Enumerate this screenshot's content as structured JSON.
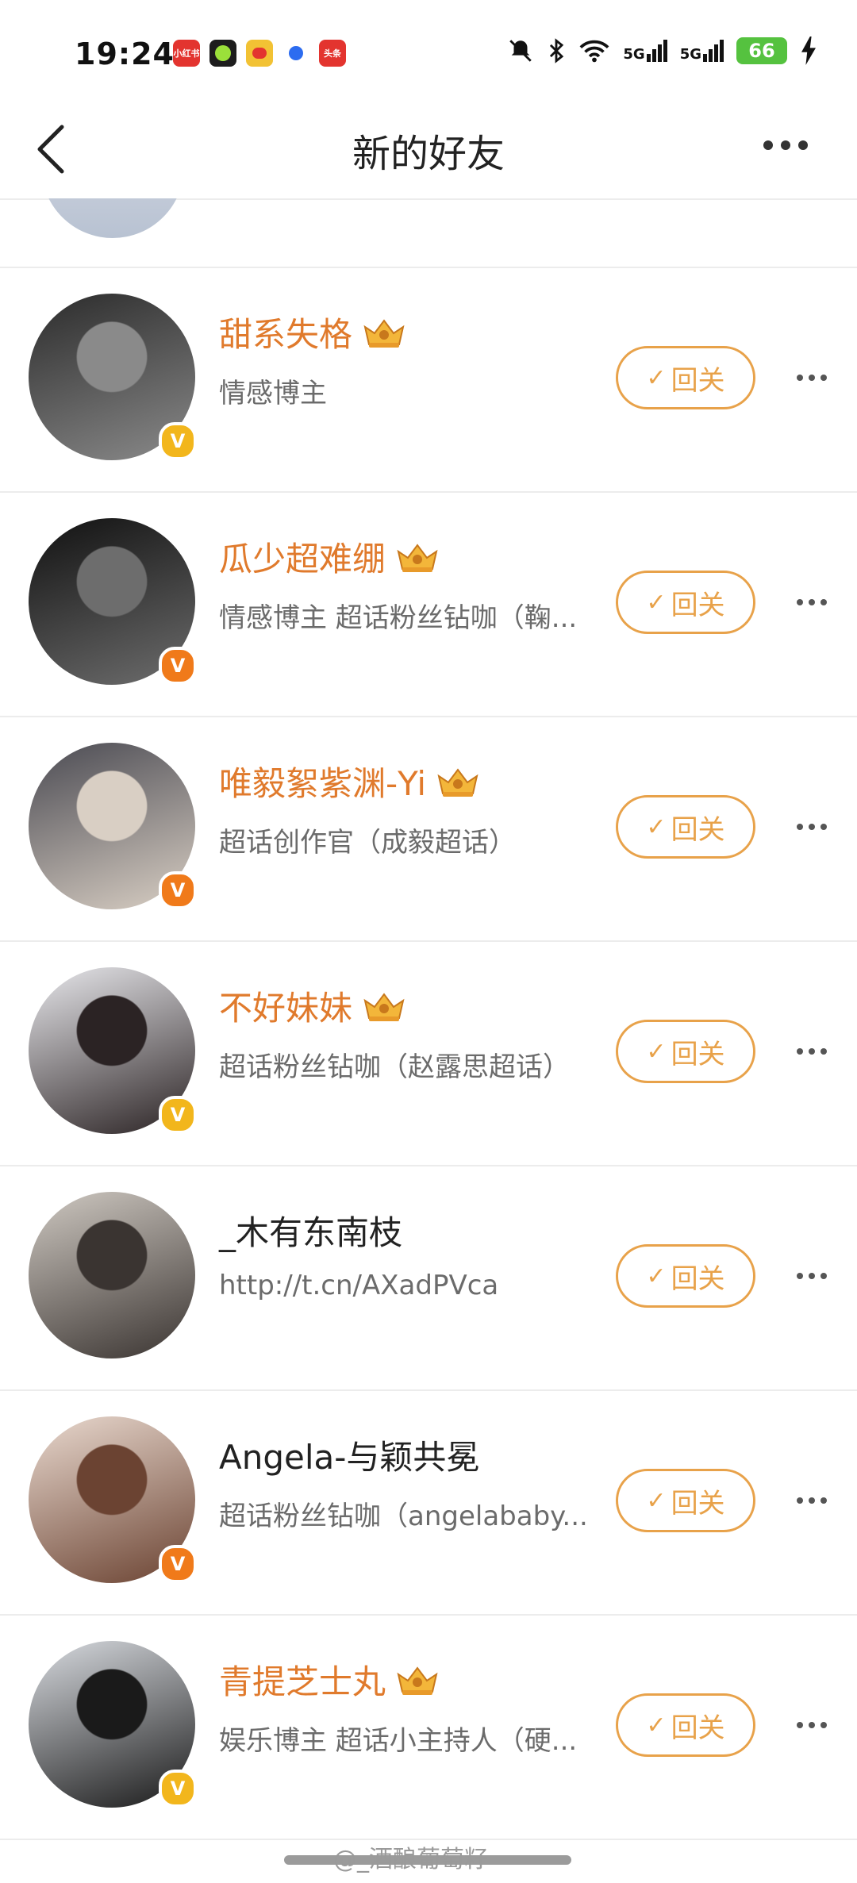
{
  "status_bar": {
    "time": "19:24",
    "app_icons": [
      {
        "name": "xiaohongshu-icon",
        "label": "小红书",
        "color": "#e3342f"
      },
      {
        "name": "green-app-icon",
        "label": "",
        "color": "#2a2a2a"
      },
      {
        "name": "weibo-icon",
        "label": "",
        "color": "#f2c234"
      },
      {
        "name": "blue-dot-app-icon",
        "label": "",
        "color": "#2c6cf0"
      },
      {
        "name": "toutiao-icon",
        "label": "头条",
        "color": "#e3342f"
      }
    ],
    "network_1": "5G",
    "network_2": "5G",
    "battery": "66"
  },
  "nav": {
    "title": "新的好友"
  },
  "friends": [
    {
      "name": "甜系失格",
      "vip": true,
      "verified_color": "#f2b61c",
      "desc": "情感博主",
      "button": "回关",
      "avatar_colors": [
        "#2b2b2b",
        "#8a8a8a"
      ]
    },
    {
      "name": "瓜少超难绷",
      "vip": true,
      "verified_color": "#f07a1a",
      "desc": "情感博主 超话粉丝钻咖（鞠...",
      "button": "回关",
      "avatar_colors": [
        "#111111",
        "#6d6d6d"
      ]
    },
    {
      "name": "唯毅絮紫渊-Yi",
      "vip": true,
      "verified_color": "#f07a1a",
      "desc": "超话创作官（成毅超话）",
      "button": "回关",
      "avatar_colors": [
        "#4a4a52",
        "#d9cfc4"
      ]
    },
    {
      "name": "不好妹妹",
      "vip": true,
      "verified_color": "#f2b61c",
      "desc": "超话粉丝钻咖（赵露思超话）",
      "button": "回关",
      "avatar_colors": [
        "#e8e8ec",
        "#2b2324"
      ]
    },
    {
      "name": "_木有东南枝",
      "vip": false,
      "verified_color": "",
      "desc": "http://t.cn/AXadPVca",
      "button": "回关",
      "avatar_colors": [
        "#cfc9c2",
        "#3a3431"
      ]
    },
    {
      "name": "Angela-与颖共冕",
      "vip": false,
      "verified_color": "#f07a1a",
      "desc": "超话粉丝钻咖（angelababy...",
      "button": "回关",
      "avatar_colors": [
        "#e9d9cf",
        "#6b4332"
      ]
    },
    {
      "name": "青提芝士丸",
      "vip": true,
      "verified_color": "#f2b61c",
      "desc": "娱乐博主 超话小主持人（硬...",
      "button": "回关",
      "avatar_colors": [
        "#d8dbe0",
        "#1a1a1a"
      ]
    }
  ],
  "watermark": "@_酒酿葡萄籽",
  "colors": {
    "accent": "#e8a24a",
    "vip_name": "#e07a2c"
  }
}
